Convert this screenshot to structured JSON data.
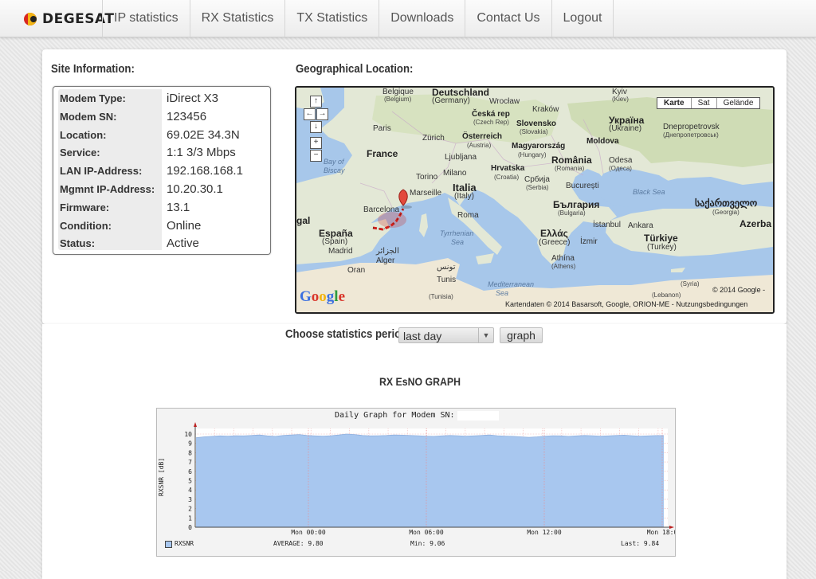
{
  "brand": {
    "name": "DEGESAT"
  },
  "nav": {
    "tabs": [
      "IP statistics",
      "RX Statistics",
      "TX Statistics",
      "Downloads",
      "Contact Us",
      "Logout"
    ]
  },
  "site_info": {
    "heading": "Site Information:",
    "rows": [
      {
        "label": "Modem Type:",
        "value": "iDirect  X3"
      },
      {
        "label": "Modem SN:",
        "value": "123456"
      },
      {
        "label": "Location:",
        "value": "69.02E  34.3N"
      },
      {
        "label": "Service:",
        "value": "1:1  3/3  Mbps"
      },
      {
        "label": "LAN IP-Address:",
        "value": "192.168.168.1"
      },
      {
        "label": "Mgmnt IP-Address:",
        "value": "10.20.30.1"
      },
      {
        "label": "Firmware:",
        "value": "13.1"
      },
      {
        "label": "Condition:",
        "value": "Online"
      },
      {
        "label": "Status:",
        "value": "Active"
      }
    ]
  },
  "geo": {
    "heading": "Geographical Location:",
    "map_types": [
      "Karte",
      "Sat",
      "Gelände"
    ],
    "marker_label": "A",
    "labels": {
      "belgique": "Belgique",
      "belgium": "(Belgium)",
      "deutschland": "Deutschland",
      "germany": "(Germany)",
      "wroclaw": "Wrocław",
      "krakow": "Kraków",
      "kyiv": "Kyiv",
      "kyiv2": "(Kiev)",
      "paris": "Paris",
      "ceska": "Česká rep",
      "czech": "(Czech Rep)",
      "slovensko": "Slovensko",
      "slovakia": "(Slovakia)",
      "ukraina": "Україна",
      "ukraine": "(Ukraine)",
      "dnepro": "Dnepropetrovsk",
      "dnepro2": "(Днепропетровськ)",
      "zurich": "Zürich",
      "osterreich": "Österreich",
      "austria": "(Austria)",
      "magyar": "Magyarország",
      "hungary": "(Hungary)",
      "moldova": "Moldova",
      "france": "France",
      "bayofbiscay": "Bay of",
      "bayofbiscay2": "Biscay",
      "ljubljana": "Ljubljana",
      "milano": "Milano",
      "hrvatska": "Hrvatska",
      "croatia": "(Croatia)",
      "romania": "România",
      "romania2": "(Romania)",
      "odesa": "Odesa",
      "odesa2": "(Одеса)",
      "torino": "Torino",
      "srbija": "Србија",
      "serbia": "(Serbia)",
      "bucuresti": "București",
      "blacksea": "Black Sea",
      "marseille": "Marseille",
      "italia": "Italia",
      "italy": "(Italy)",
      "bulgaria": "България",
      "bulgaria2": "(Bulgaria)",
      "georgia": "საქართველო",
      "georgia2": "(Georgia)",
      "barcelona": "Barcelona",
      "roma": "Roma",
      "gal": "gal",
      "istanbul": "İstanbul",
      "ankara": "Ankara",
      "azerba": "Azerba",
      "espana": "España",
      "spain": "(Spain)",
      "tyrrhenian": "Tyrrhenian",
      "tyrrhenian2": "Sea",
      "ellada": "Ελλάς",
      "greece": "(Greece)",
      "izmir": "İzmir",
      "turkiye": "Türkiye",
      "turkey": "(Turkey)",
      "madrid": "Madrid",
      "alger": "Alger",
      "alger2": "الجزائر",
      "athina": "Athína",
      "athina2": "(Athens)",
      "oran": "Oran",
      "tunis": "Tunis",
      "tunis2": "تونس",
      "tunisia": "(Tunisia)",
      "medsea": "Mediterranean",
      "medsea2": "Sea",
      "lebanon": "(Lebanon)",
      "syria": "(Syria)"
    },
    "copyright": "© 2014 Google -",
    "attribution": "Kartendaten © 2014 Basarsoft, Google, ORION-ME - Nutzungsbedingungen",
    "google_logo": "Google"
  },
  "stats": {
    "period_label": "Choose statistics period",
    "period_value": "last day",
    "graph_button": "graph",
    "graph_heading": "RX EsNO GRAPH"
  },
  "chart_data": {
    "type": "area",
    "title": "Daily Graph for Modem SN:",
    "ylabel": "RXSNR [dB]",
    "ylim": [
      0,
      10
    ],
    "yticks": [
      "0",
      "1",
      "2",
      "3",
      "4",
      "5",
      "6",
      "7",
      "8",
      "9",
      "10"
    ],
    "xticks": [
      "Mon 00:00",
      "Mon 06:00",
      "Mon 12:00",
      "Mon 18:0"
    ],
    "grid": true,
    "legend": "bottom-left",
    "color": "#a8c7ef",
    "series": [
      {
        "name": "RXSNR",
        "values": [
          9.6,
          9.7,
          9.75,
          9.8,
          9.78,
          9.82,
          9.8,
          9.85,
          9.9,
          9.8,
          9.75,
          9.85,
          9.9,
          9.95,
          9.85,
          9.8,
          9.78,
          9.82,
          9.9,
          10.0,
          9.95,
          9.85,
          9.8,
          9.82,
          9.85,
          9.9,
          9.88,
          9.85,
          9.82,
          9.78,
          9.75,
          9.8,
          9.85,
          9.82,
          9.78,
          9.8,
          9.85,
          9.9,
          9.82,
          9.78,
          9.75,
          9.7,
          9.65,
          9.7,
          9.78,
          9.82,
          9.8,
          9.75,
          9.8,
          9.85,
          9.82,
          9.78,
          9.8,
          9.85,
          9.88,
          9.82,
          9.78,
          9.8,
          9.84,
          9.84
        ]
      }
    ],
    "stats": {
      "legend_label": "RXSNR",
      "average": "AVERAGE:  9.80",
      "min": "Min:  9.06",
      "last": "Last:  9.84"
    }
  }
}
